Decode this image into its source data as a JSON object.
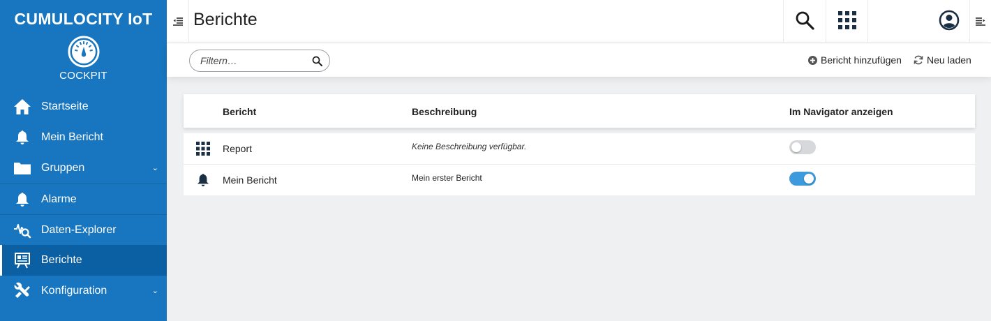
{
  "brand": "CUMULOCITY IoT",
  "app_name": "COCKPIT",
  "nav": [
    {
      "label": "Startseite",
      "icon": "home-icon"
    },
    {
      "label": "Mein Bericht",
      "icon": "bell-icon"
    },
    {
      "label": "Gruppen",
      "icon": "folder-icon",
      "expandable": true
    },
    {
      "label": "Alarme",
      "icon": "bell-icon"
    },
    {
      "label": "Daten-Explorer",
      "icon": "data-explorer-icon"
    },
    {
      "label": "Berichte",
      "icon": "report-icon",
      "active": true
    },
    {
      "label": "Konfiguration",
      "icon": "wrench-icon",
      "expandable": true
    }
  ],
  "header": {
    "title": "Berichte"
  },
  "actionbar": {
    "filter_placeholder": "Filtern…",
    "add_label": "Bericht hinzufügen",
    "reload_label": "Neu laden"
  },
  "table": {
    "columns": [
      "Bericht",
      "Beschreibung",
      "Im Navigator anzeigen"
    ],
    "rows": [
      {
        "name": "Report",
        "description": "Keine Beschreibung verfügbar.",
        "icon": "grid-icon",
        "show_in_navigator": false
      },
      {
        "name": "Mein Bericht",
        "description": "Mein erster Bericht",
        "icon": "bell-icon",
        "show_in_navigator": true
      }
    ]
  },
  "colors": {
    "sidebar": "#1776bf",
    "active_nav": "#0b5fa3",
    "toggle_on": "#3d9bdd",
    "background": "#eff0f2"
  }
}
